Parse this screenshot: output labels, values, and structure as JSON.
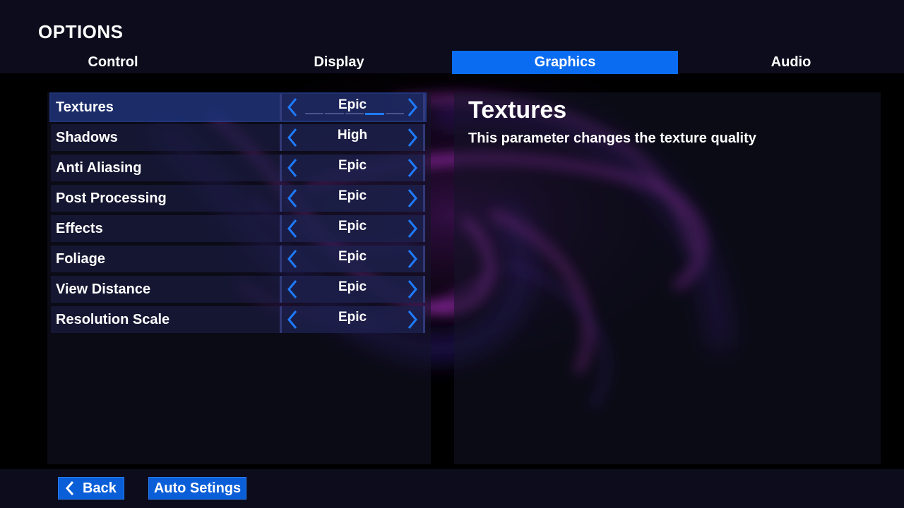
{
  "header": {
    "title": "OPTIONS",
    "tabs": [
      {
        "label": "Control",
        "active": false
      },
      {
        "label": "Display",
        "active": false
      },
      {
        "label": "Graphics",
        "active": true
      },
      {
        "label": "Audio",
        "active": false
      }
    ]
  },
  "settings": [
    {
      "label": "Textures",
      "value": "Epic",
      "selected": true
    },
    {
      "label": "Shadows",
      "value": "High",
      "selected": false
    },
    {
      "label": "Anti Aliasing",
      "value": "Epic",
      "selected": false
    },
    {
      "label": "Post Processing",
      "value": "Epic",
      "selected": false
    },
    {
      "label": "Effects",
      "value": "Epic",
      "selected": false
    },
    {
      "label": "Foliage",
      "value": "Epic",
      "selected": false
    },
    {
      "label": "View Distance",
      "value": "Epic",
      "selected": false
    },
    {
      "label": "Resolution Scale",
      "value": "Epic",
      "selected": false
    }
  ],
  "selected_level": {
    "options_count": 5,
    "current_index": 3
  },
  "description": {
    "title": "Textures",
    "text": "This parameter changes the texture quality"
  },
  "footer": {
    "back_label": "Back",
    "auto_label": "Auto Setings"
  },
  "colors": {
    "accent": "#0a6cf0",
    "arrow": "#1e7bff",
    "bar": "#0c0c1c"
  }
}
